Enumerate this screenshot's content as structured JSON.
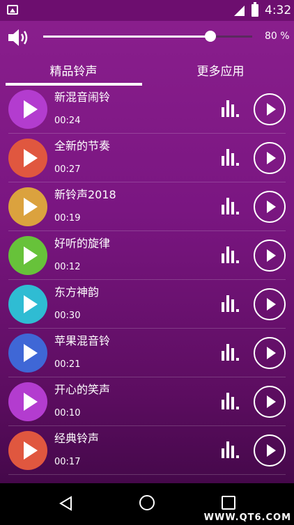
{
  "status_bar": {
    "time": "4:32"
  },
  "volume": {
    "percent_label": "80 %",
    "level": 0.8
  },
  "tabs": [
    {
      "label": "精品铃声",
      "active": true
    },
    {
      "label": "更多应用",
      "active": false
    }
  ],
  "ringtones": [
    {
      "title": "新混音闹铃",
      "duration": "00:24",
      "color": "#b33ccf"
    },
    {
      "title": "全新的节奏",
      "duration": "00:27",
      "color": "#e0573f"
    },
    {
      "title": "新铃声2018",
      "duration": "00:19",
      "color": "#dba23e"
    },
    {
      "title": "好听的旋律",
      "duration": "00:12",
      "color": "#67c23a"
    },
    {
      "title": "东方神韵",
      "duration": "00:30",
      "color": "#2fbcd3"
    },
    {
      "title": "苹果混音铃",
      "duration": "00:21",
      "color": "#3f67d6"
    },
    {
      "title": "开心的笑声",
      "duration": "00:10",
      "color": "#b33ccf"
    },
    {
      "title": "经典铃声",
      "duration": "00:17",
      "color": "#e0573f"
    }
  ],
  "watermark": "WWW.QT6.COM",
  "colors": {
    "background_top": "#8b1f8e",
    "background_bottom": "#3a0640",
    "status_bar": "#6d0e6f"
  }
}
